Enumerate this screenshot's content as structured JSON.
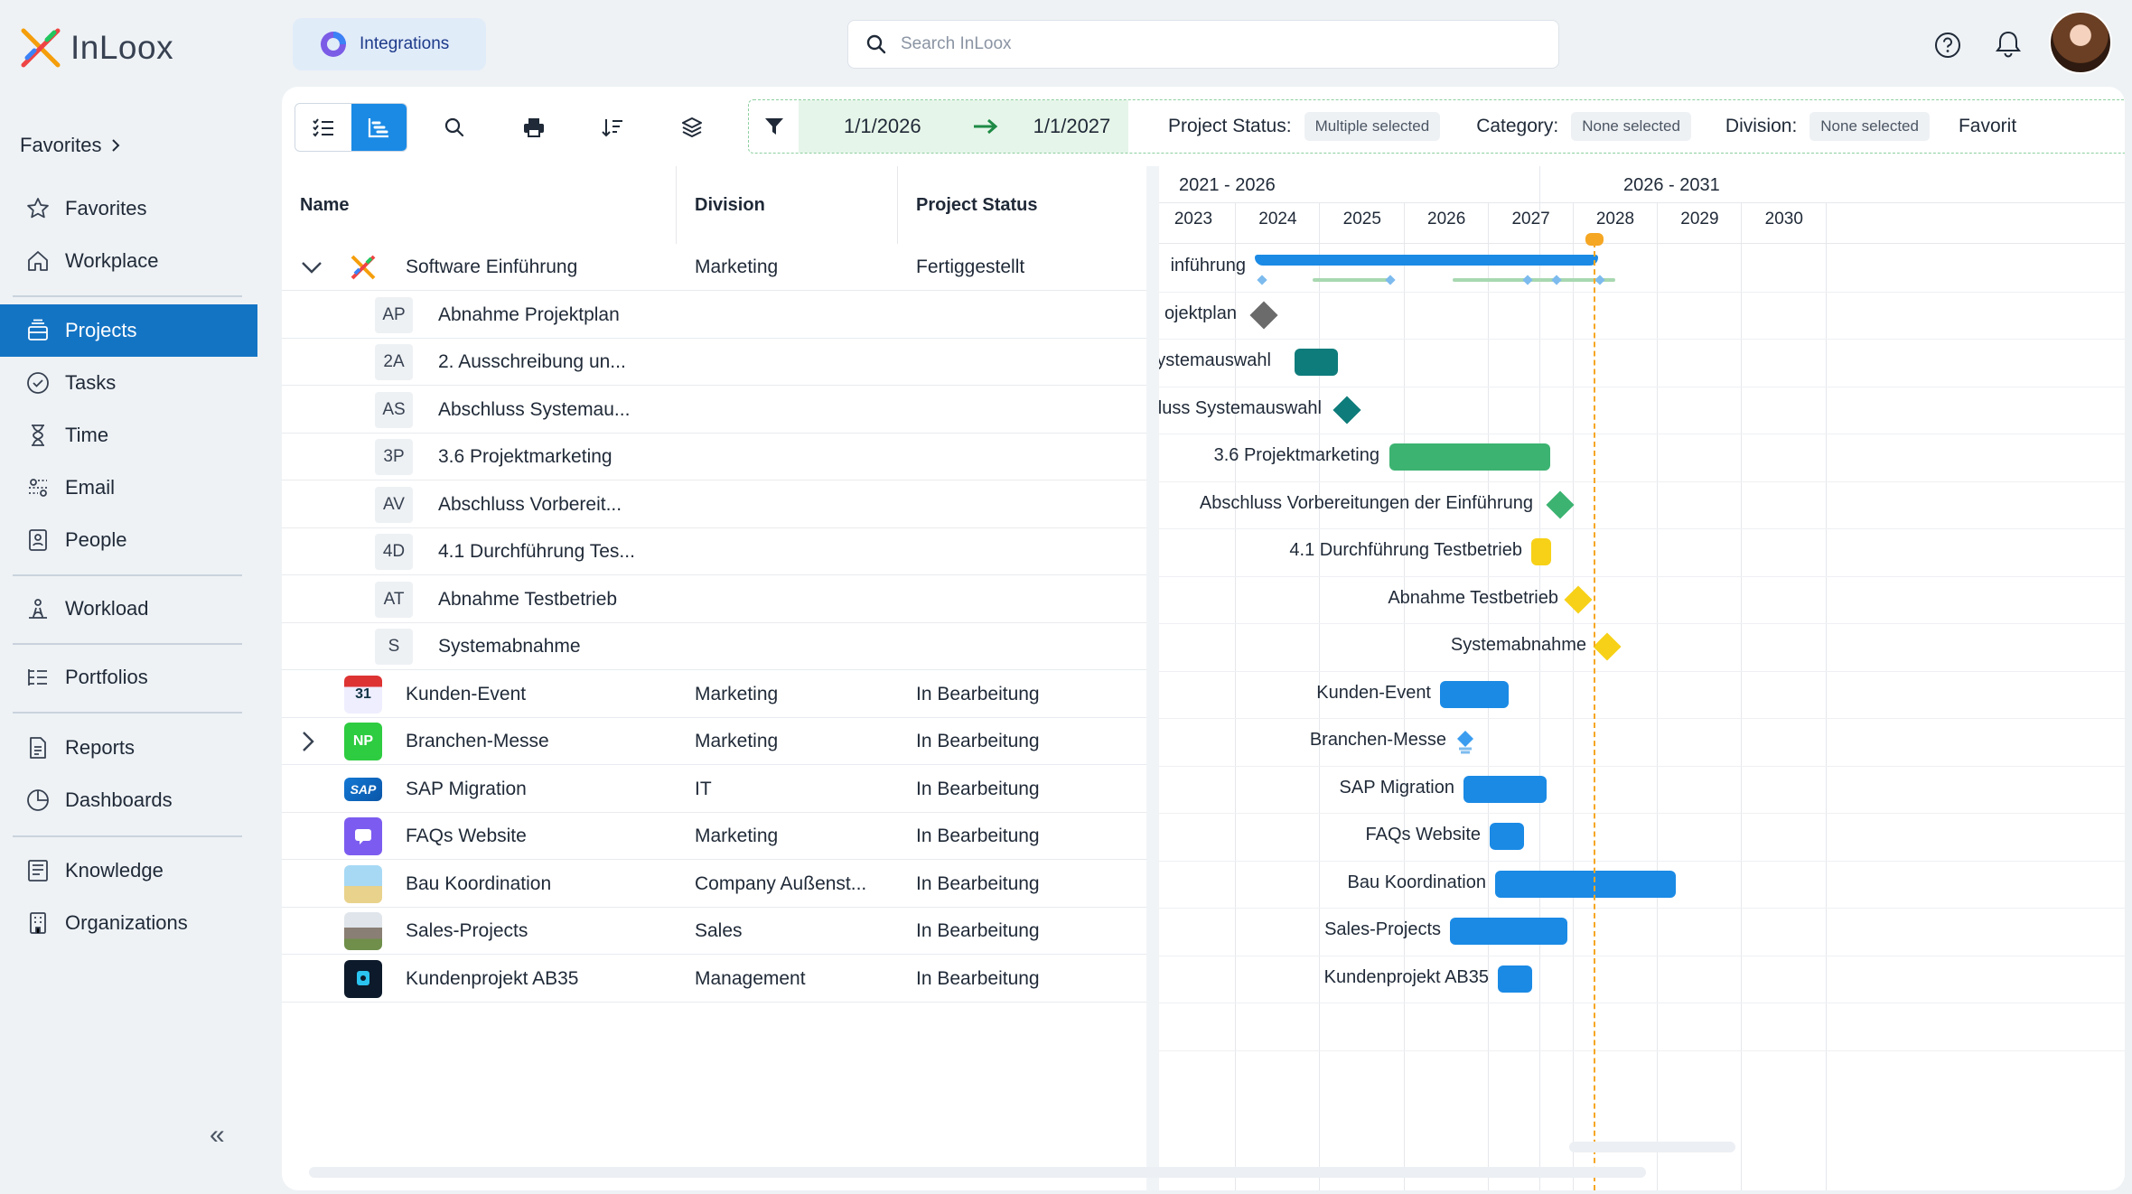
{
  "app": {
    "name": "InLoox"
  },
  "topbar": {
    "integrations_label": "Integrations",
    "search_placeholder": "Search InLoox",
    "icons": [
      "help-icon",
      "bell-icon",
      "avatar"
    ]
  },
  "sidebar": {
    "favorites_header": "Favorites",
    "items": [
      {
        "label": "Favorites",
        "icon": "star-icon"
      },
      {
        "label": "Workplace",
        "icon": "home-icon"
      },
      {
        "label": "Projects",
        "icon": "projects-icon",
        "active": true
      },
      {
        "label": "Tasks",
        "icon": "check-circle-icon"
      },
      {
        "label": "Time",
        "icon": "hourglass-icon"
      },
      {
        "label": "Email",
        "icon": "email-icon"
      },
      {
        "label": "People",
        "icon": "contact-icon"
      },
      {
        "label": "Workload",
        "icon": "workload-icon"
      },
      {
        "label": "Portfolios",
        "icon": "portfolio-icon"
      },
      {
        "label": "Reports",
        "icon": "report-icon"
      },
      {
        "label": "Dashboards",
        "icon": "dashboard-icon"
      },
      {
        "label": "Knowledge",
        "icon": "book-icon"
      },
      {
        "label": "Organizations",
        "icon": "building-icon"
      }
    ],
    "collapse_label": "«"
  },
  "toolbar": {
    "date_from": "1/1/2026",
    "date_to": "1/1/2027",
    "filters": [
      {
        "label": "Project Status:",
        "value": "Multiple selected"
      },
      {
        "label": "Category:",
        "value": "None selected"
      },
      {
        "label": "Division:",
        "value": "None selected"
      },
      {
        "label": "Favorit",
        "value": ""
      }
    ]
  },
  "table": {
    "columns": [
      "Name",
      "Division",
      "Project Status"
    ],
    "rows": [
      {
        "type": "project",
        "expand": "down",
        "icon": "inloox-logo",
        "name": "Software Einführung",
        "division": "Marketing",
        "status": "Fertiggestellt",
        "bold": true
      },
      {
        "type": "task",
        "abbr": "AP",
        "name": "Abnahme Projektplan"
      },
      {
        "type": "task",
        "abbr": "2A",
        "name": "2. Ausschreibung un..."
      },
      {
        "type": "task",
        "abbr": "AS",
        "name": "Abschluss Systemau..."
      },
      {
        "type": "task",
        "abbr": "3P",
        "name": "3.6 Projektmarketing"
      },
      {
        "type": "task",
        "abbr": "AV",
        "name": "Abschluss Vorbereit..."
      },
      {
        "type": "task",
        "abbr": "4D",
        "name": "4.1 Durchführung Tes..."
      },
      {
        "type": "task",
        "abbr": "AT",
        "name": "Abnahme Testbetrieb"
      },
      {
        "type": "task",
        "abbr": "S",
        "name": "Systemabnahme"
      },
      {
        "type": "project",
        "icon": "calendar-img",
        "name": "Kunden-Event",
        "division": "Marketing",
        "status": "In Bearbeitung"
      },
      {
        "type": "project",
        "expand": "right",
        "icon": "np-badge",
        "icon_text": "NP",
        "name": "Branchen-Messe",
        "division": "Marketing",
        "status": "In Bearbeitung",
        "bold": true
      },
      {
        "type": "project",
        "icon": "sap-logo",
        "icon_text": "SAP",
        "name": "SAP Migration",
        "division": "IT",
        "status": "In Bearbeitung"
      },
      {
        "type": "project",
        "icon": "faq-icon",
        "name": "FAQs Website",
        "division": "Marketing",
        "status": "In Bearbeitung"
      },
      {
        "type": "project",
        "icon": "construction-img",
        "name": "Bau Koordination",
        "division": "Company Außenst...",
        "status": "In Bearbeitung"
      },
      {
        "type": "project",
        "icon": "house-img",
        "name": "Sales-Projects",
        "division": "Sales",
        "status": "In Bearbeitung"
      },
      {
        "type": "project",
        "icon": "app-icon",
        "name": "Kundenprojekt AB35",
        "division": "Management",
        "status": "In Bearbeitung"
      }
    ]
  },
  "gantt": {
    "period_labels": [
      "2021 - 2026",
      "2026 - 2031"
    ],
    "years": [
      "2023",
      "2024",
      "2025",
      "2026",
      "2027",
      "2028",
      "2029",
      "2030"
    ],
    "bar_labels": [
      "inführung",
      "ojektplan",
      "l Systemauswahl",
      "chluss Systemauswahl",
      "3.6 Projektmarketing",
      "Abschluss Vorbereitungen der Einführung",
      "4.1 Durchführung Testbetrieb",
      "Abnahme Testbetrieb",
      "Systemabnahme",
      "Kunden-Event",
      "Branchen-Messe",
      "SAP Migration",
      "FAQs Website",
      "Bau Koordination",
      "Sales-Projects",
      "Kundenprojekt AB35"
    ],
    "colors": {
      "blue": "#1a8ae5",
      "teal": "#0e7c7b",
      "green": "#3cb371",
      "yellow": "#f7d117",
      "gray": "#6b6b6b",
      "today": "#f5a623"
    }
  }
}
